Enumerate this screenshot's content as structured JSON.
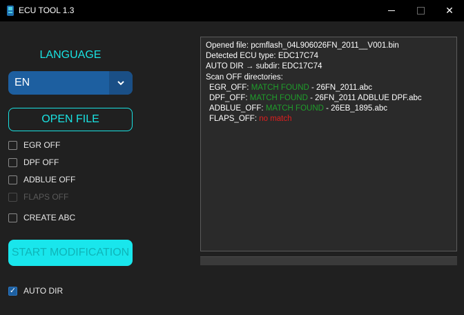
{
  "window": {
    "title": "ECU TOOL 1.3",
    "accent": "#19e3e3",
    "minimize_glyph": "",
    "close_glyph": "✕"
  },
  "language": {
    "label": "LANGUAGE",
    "selected": "EN"
  },
  "open_file": {
    "label": "OPEN FILE"
  },
  "options": [
    {
      "label": "EGR OFF",
      "checked": false,
      "enabled": true
    },
    {
      "label": "DPF OFF",
      "checked": false,
      "enabled": true
    },
    {
      "label": "ADBLUE OFF",
      "checked": false,
      "enabled": true
    },
    {
      "label": "FLAPS OFF",
      "checked": false,
      "enabled": false
    },
    {
      "label": "CREATE ABC",
      "checked": false,
      "enabled": true
    }
  ],
  "start_button": {
    "label": "START MODIFICATION"
  },
  "auto_dir": {
    "label": "AUTO DIR",
    "checked": true,
    "check_glyph": "✓"
  },
  "log": {
    "line1": "Opened file: pcmflash_04L906026FN_2011__V001.bin",
    "line2": "Detected ECU type: EDC17C74",
    "line3": "AUTO DIR → subdir: EDC17C74",
    "line4": "Scan OFF directories:",
    "egr": {
      "key": "EGR_OFF: ",
      "status": "MATCH FOUND",
      "file": " - 26FN_2011.abc"
    },
    "dpf": {
      "key": "DPF_OFF: ",
      "status": "MATCH FOUND",
      "file": " - 26FN_2011 ADBLUE DPF.abc"
    },
    "adblue": {
      "key": "ADBLUE_OFF: ",
      "status": "MATCH FOUND",
      "file": " - 26EB_1895.abc"
    },
    "flaps": {
      "key": "FLAPS_OFF: ",
      "status": "no match"
    }
  },
  "progress": {
    "value": 0
  }
}
